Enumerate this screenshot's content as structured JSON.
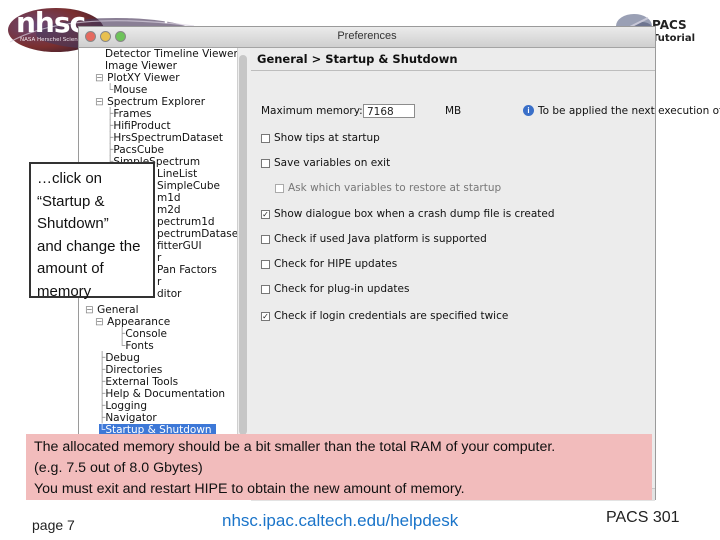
{
  "logo": {
    "main_text": "nhsc",
    "sub_text": "NASA Herschel Science Center"
  },
  "top_right_logo": {
    "text_line1": "PACS",
    "text_line2": "Tutorial"
  },
  "window": {
    "title": "Preferences",
    "tree": {
      "items": [
        "Detector Timeline Viewer",
        "Image Viewer",
        "PlotXY Viewer",
        "Mouse",
        "Spectrum Explorer",
        "Frames",
        "HifiProduct",
        "HrsSpectrumDataset",
        "PacsCube",
        "SimpleSpectrum",
        "LineList",
        "SimpleCube",
        "m1d",
        "m2d",
        "pectrum1d",
        "pectrumDataset",
        "fitterGUI",
        "r",
        "Pan Factors",
        "r",
        "ditor",
        "General",
        "Appearance",
        "Console",
        "Fonts",
        "Debug",
        "Directories",
        "External Tools",
        "Help & Documentation",
        "Logging",
        "Navigator",
        "Startup & Shutdown"
      ]
    },
    "breadcrumb": "General > Startup & Shutdown",
    "max_memory": {
      "label": "Maximum memory:",
      "value": "7168",
      "unit": "MB",
      "hint": "To be applied the next execution of HI"
    },
    "options": [
      {
        "label": "Show tips at startup",
        "checked": false
      },
      {
        "label": "Save variables on exit",
        "checked": false
      },
      {
        "label": "Ask which variables to restore at startup",
        "checked": false
      },
      {
        "label": "Show dialogue box when a crash dump file is created",
        "checked": true
      },
      {
        "label": "Check if used Java platform is supported",
        "checked": false
      },
      {
        "label": "Check for HIPE updates",
        "checked": false
      },
      {
        "label": "Check for plug-in updates",
        "checked": false
      },
      {
        "label": "Check if login credentials are specified twice",
        "checked": true
      }
    ]
  },
  "callout": {
    "lines": [
      "…click on",
      "“Startup &",
      "Shutdown”",
      "and change the",
      "amount of",
      "memory"
    ]
  },
  "note": {
    "lines": [
      "The allocated memory should be a bit smaller than the total RAM of your computer.",
      "(e.g. 7.5 out of 8.0 Gbytes)",
      "You must exit and restart HIPE to obtain the new amount of memory."
    ]
  },
  "footer": {
    "page": "page 7",
    "link": "nhsc.ipac.caltech.edu/helpdesk",
    "course": "PACS 301"
  },
  "colors": {
    "accent": "#3d78d7",
    "note_bg": "#f2bcbc",
    "link": "#1a74c9"
  }
}
